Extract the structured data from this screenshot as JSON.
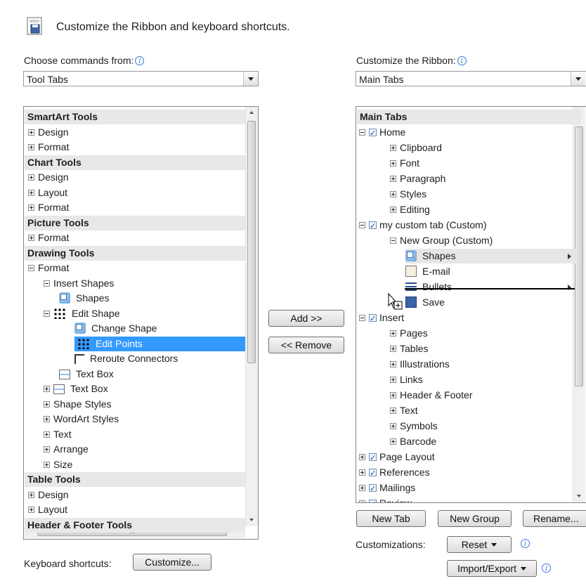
{
  "header": {
    "title": "Customize the Ribbon and keyboard shortcuts.",
    "icon": "customize-ribbon-icon"
  },
  "left": {
    "label": "Choose commands from:",
    "label_underline_char": "C",
    "combo_value": "Tool Tabs",
    "items": [
      {
        "text": "SmartArt Tools",
        "kind": "category"
      },
      {
        "text": "Design",
        "kind": "expand",
        "indent": 0
      },
      {
        "text": "Format",
        "kind": "expand",
        "indent": 0
      },
      {
        "text": "Chart Tools",
        "kind": "category"
      },
      {
        "text": "Design",
        "kind": "expand",
        "indent": 0
      },
      {
        "text": "Layout",
        "kind": "expand",
        "indent": 0
      },
      {
        "text": "Format",
        "kind": "expand",
        "indent": 0
      },
      {
        "text": "Picture Tools",
        "kind": "category"
      },
      {
        "text": "Format",
        "kind": "expand",
        "indent": 0
      },
      {
        "text": "Drawing Tools",
        "kind": "category"
      },
      {
        "text": "Format",
        "kind": "collapse",
        "indent": 0
      },
      {
        "text": "Insert Shapes",
        "kind": "collapse",
        "indent": 1
      },
      {
        "text": "Shapes",
        "kind": "icon",
        "icon": "shapes-icon",
        "indent": 2
      },
      {
        "text": "Edit Shape",
        "kind": "collapse-icon",
        "icon": "edit-points-icon",
        "indent": 1
      },
      {
        "text": "Change Shape",
        "kind": "icon",
        "icon": "shapes-icon",
        "indent": 3
      },
      {
        "text": "Edit Points",
        "kind": "icon",
        "icon": "edit-points-icon",
        "indent": 3,
        "selected": true
      },
      {
        "text": "Reroute Connectors",
        "kind": "icon",
        "icon": "reroute-connectors-icon",
        "indent": 3
      },
      {
        "text": "Text Box",
        "kind": "icon",
        "icon": "text-box-icon",
        "indent": 2
      },
      {
        "text": "Text Box",
        "kind": "expand-icon",
        "icon": "text-box-icon",
        "indent": 1
      },
      {
        "text": "Shape Styles",
        "kind": "expand",
        "indent": 1
      },
      {
        "text": "WordArt Styles",
        "kind": "expand",
        "indent": 1
      },
      {
        "text": "Text",
        "kind": "expand",
        "indent": 1
      },
      {
        "text": "Arrange",
        "kind": "expand",
        "indent": 1
      },
      {
        "text": "Size",
        "kind": "expand",
        "indent": 1
      },
      {
        "text": "Table Tools",
        "kind": "category"
      },
      {
        "text": "Design",
        "kind": "expand",
        "indent": 0
      },
      {
        "text": "Layout",
        "kind": "expand",
        "indent": 0
      },
      {
        "text": "Header & Footer Tools",
        "kind": "category"
      }
    ],
    "hscroll_grip": "III"
  },
  "middle": {
    "add_label": "Add >>",
    "remove_label": "<< Remove"
  },
  "right": {
    "label": "Customize the Ribbon:",
    "combo_value": "Main Tabs",
    "items": [
      {
        "text": "Main Tabs",
        "kind": "category"
      },
      {
        "text": "Home",
        "kind": "collapse-check",
        "indent": 0
      },
      {
        "text": "Clipboard",
        "kind": "expand",
        "indent": 2
      },
      {
        "text": "Font",
        "kind": "expand",
        "indent": 2
      },
      {
        "text": "Paragraph",
        "kind": "expand",
        "indent": 2
      },
      {
        "text": "Styles",
        "kind": "expand",
        "indent": 2
      },
      {
        "text": "Editing",
        "kind": "expand",
        "indent": 2
      },
      {
        "text": "my custom tab (Custom)",
        "kind": "collapse-check",
        "indent": 0
      },
      {
        "text": "New Group (Custom)",
        "kind": "collapse",
        "indent": 2
      },
      {
        "text": "Shapes",
        "kind": "icon",
        "icon": "shapes-icon",
        "indent": 3,
        "hover": true,
        "submenu": true
      },
      {
        "text": "E-mail",
        "kind": "icon",
        "icon": "email-icon",
        "indent": 3
      },
      {
        "text": "Bullets",
        "kind": "icon",
        "icon": "bullets-icon",
        "indent": 3,
        "submenu": true
      },
      {
        "text": "Save",
        "kind": "icon",
        "icon": "save-icon",
        "indent": 3
      },
      {
        "text": "Insert",
        "kind": "collapse-check",
        "indent": 0,
        "partial": "I",
        "tail": "t"
      },
      {
        "text": "Pages",
        "kind": "expand",
        "indent": 2
      },
      {
        "text": "Tables",
        "kind": "expand",
        "indent": 2
      },
      {
        "text": "Illustrations",
        "kind": "expand",
        "indent": 2
      },
      {
        "text": "Links",
        "kind": "expand",
        "indent": 2
      },
      {
        "text": "Header & Footer",
        "kind": "expand",
        "indent": 2
      },
      {
        "text": "Text",
        "kind": "expand",
        "indent": 2
      },
      {
        "text": "Symbols",
        "kind": "expand",
        "indent": 2
      },
      {
        "text": "Barcode",
        "kind": "expand",
        "indent": 2
      },
      {
        "text": "Page Layout",
        "kind": "expand-check",
        "indent": 0
      },
      {
        "text": "References",
        "kind": "expand-check",
        "indent": 0
      },
      {
        "text": "Mailings",
        "kind": "expand-check",
        "indent": 0
      },
      {
        "text": "Review",
        "kind": "expand-check",
        "indent": 0
      }
    ],
    "new_tab_label": "New Tab",
    "new_group_label": "New Group",
    "rename_label": "Rename...",
    "customizations_label": "Customizations:",
    "reset_label": "Reset",
    "import_export_label": "Import/Export"
  },
  "footer": {
    "keyboard_label": "Keyboard shortcuts:",
    "customize_label": "Customize..."
  }
}
